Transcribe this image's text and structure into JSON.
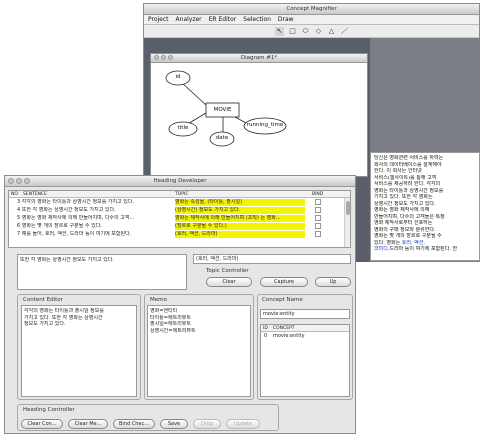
{
  "magnifier": {
    "title": "Concept Magnifier",
    "menu": [
      "Project",
      "Analyzer",
      "ER Editor",
      "Selection",
      "Draw"
    ],
    "tools": [
      "arrow-pointer-icon",
      "rectangle-icon",
      "ellipse-icon",
      "diamond-icon",
      "triangle-icon",
      "line-icon"
    ],
    "diagram": {
      "title": "Diagram #1*",
      "entity": "MOVIE",
      "attributes": [
        "id",
        "title",
        "date",
        "running_time"
      ]
    },
    "korean_text": [
      "당신은 영화관련 서비스를 하려는",
      "회사의 데이터베이스를 설계해야",
      "한다. 이 회사는 인터넷",
      "서비스(웹사이트)를 통해 고객",
      "서비스를 제공하려 한다. 각각의",
      "영화는 타이틀과 상영시간 정보를",
      "가지고 있다. 또한 각 영화는",
      "상영시간 정보도 가지고 있다.",
      "영화는 영화 제작사에 의해",
      "만들어지며, 다수의 고객들은 특정",
      "영화 제작사로부터 선호하는",
      "영화의 구매 정보와 분류한다.",
      "영화는 몇 개의 장르로 구분될 수",
      "있다. 영화는 ",
      "드라마 등이 여기에 포함된다. 한"
    ],
    "korean_link_1": "호러, 액션,",
    "korean_link_2": "코미디,"
  },
  "developer": {
    "title": "Heading Developer",
    "table": {
      "headers": [
        "NO",
        "SENTENCE",
        "TOPIC",
        "BIND"
      ],
      "rows": [
        {
          "sentence": "3 각각의 영화는 타이틀과 상영시간 정보를 가지고 있다.",
          "topic": "영화는 속성을, (타이틀, 출시일)"
        },
        {
          "sentence": "4 또한 각 영화는 상영시간 정보도 가지고 있다.",
          "topic": "(상영시간) 정보도 가지고 있다."
        },
        {
          "sentence": "5 영화는 영화 제작사에 의해 만들어지며, 다수의 고객...",
          "topic": "영화는 제작사에 의해 만들어지며 (조직) 는 영화..."
        },
        {
          "sentence": "6 영화는 몇 개의 장르로 구분될 수 있다.",
          "topic": "(장르로 구분될 수 있다.)"
        },
        {
          "sentence": "7 예를 들어, 호러, 액션, 드라마 등이 여기에 포함된다.",
          "topic": "(호러, 액션, 드라마)"
        }
      ]
    },
    "sentence_text": "또한 각 영화는 상영시간 정보도 가지고 있다.",
    "topic_field": "(호러, 액션, 드라마)",
    "topic_controller": {
      "label": "Topic Controller",
      "buttons": [
        "Clear",
        "Capture",
        "Up"
      ]
    },
    "content_editor": {
      "label": "Content Editor",
      "text": [
        "각각의 영화는 타이틀과 출시일 정보를",
        "가지고 있다. 또한 각 영화는 상영시간",
        "정보도 가지고 있다."
      ]
    },
    "memo": {
      "label": "Memo",
      "lines": [
        "영화=엔티티",
        "타이틀=애트리뷰트",
        "출시일=애트리뷰트",
        "상영시간=애트리뷰트"
      ]
    },
    "concept_name": {
      "label": "Concept Name",
      "value": "movie:entity",
      "headers": [
        "ID",
        "CONCEPT"
      ],
      "rows": [
        {
          "id": "0",
          "concept": "movie:entity"
        }
      ]
    },
    "heading_controller": {
      "label": "Heading Controller",
      "buttons": [
        {
          "label": "Clear Con...",
          "enabled": true
        },
        {
          "label": "Clear Me...",
          "enabled": true
        },
        {
          "label": "Bind Chec...",
          "enabled": true
        },
        {
          "label": "Save",
          "enabled": true
        },
        {
          "label": "Drop",
          "enabled": false
        },
        {
          "label": "Update",
          "enabled": false
        }
      ]
    }
  },
  "colors": {
    "highlight": "#f4f400",
    "link": "#1a3bb5"
  }
}
